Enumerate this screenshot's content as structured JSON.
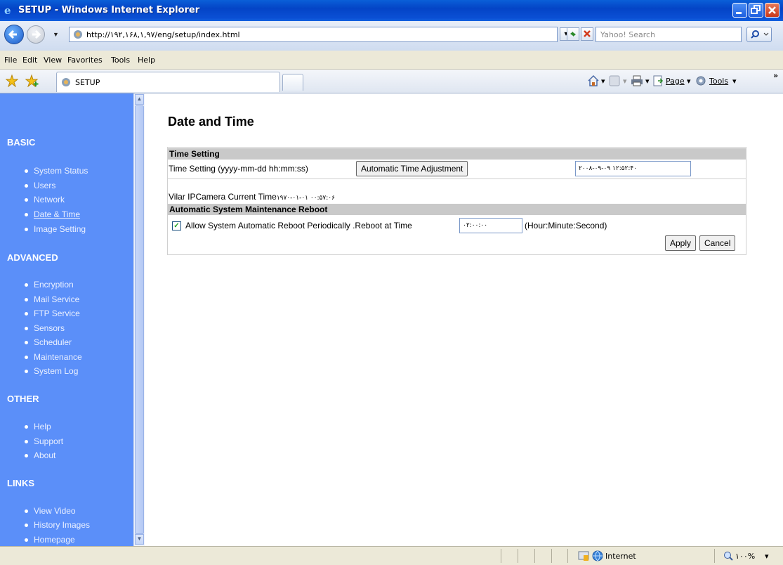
{
  "window": {
    "title": "SETUP - Windows Internet Explorer"
  },
  "address_bar": {
    "url": "http://۱۹۲,۱۶۸,۱,۹۷/eng/setup/index.html",
    "search_placeholder": "Yahoo! Search"
  },
  "menu": {
    "items": [
      "File",
      "Edit",
      "View",
      "Favorites",
      "Tools",
      "Help"
    ]
  },
  "tabs": {
    "active_label": "SETUP",
    "page_label": "Page",
    "tools_label": "Tools"
  },
  "sidebar": {
    "sections": [
      {
        "heading": "BASIC",
        "items": [
          "System Status",
          "Users",
          "Network",
          "Date & Time",
          "Image Setting"
        ]
      },
      {
        "heading": "ADVANCED",
        "items": [
          "Encryption",
          "Mail Service",
          "FTP Service",
          "Sensors",
          "Scheduler",
          "Maintenance",
          "System Log"
        ]
      },
      {
        "heading": "OTHER",
        "items": [
          "Help",
          "Support",
          "About"
        ]
      },
      {
        "heading": "LINKS",
        "items": [
          "View Video",
          "History Images",
          "Homepage"
        ]
      }
    ],
    "active_item": "Date & Time"
  },
  "main": {
    "title": "Date and Time",
    "time_setting": {
      "header": "Time Setting",
      "label": "Time Setting (yyyy-mm-dd hh:mm:ss)",
      "auto_button": "Automatic Time Adjustment",
      "value": "۲۰۰۸-۰۹-۰۹ ۱۲:۵۲:۴۰",
      "current_time_label": "Vilar IPCamera Current Time",
      "current_time_value": "۱۹۷۰-۰۱-۰۱ ۰۰:۵۷:۰۶"
    },
    "reboot": {
      "header": "Automatic System Maintenance Reboot",
      "checkbox_label": "Allow System Automatic Reboot Periodically .Reboot at Time",
      "checked": true,
      "time_value": "۰۲:۰۰:۰۰",
      "time_hint": "(Hour:Minute:Second)"
    },
    "apply_label": "Apply",
    "cancel_label": "Cancel"
  },
  "status_bar": {
    "zone": "Internet",
    "zoom": "۱۰۰%"
  }
}
